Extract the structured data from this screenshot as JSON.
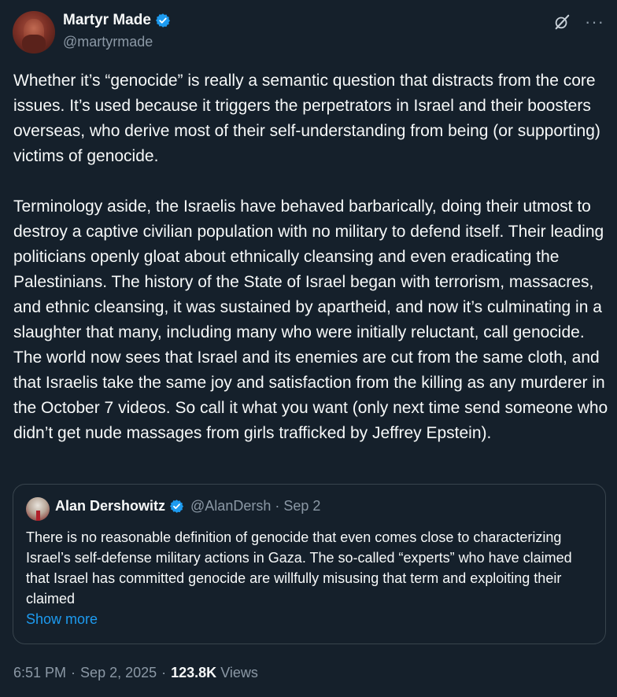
{
  "author": {
    "display_name": "Martyr Made",
    "handle": "@martyrmade",
    "verified": true
  },
  "icons": {
    "verified": "verified-badge-icon",
    "grok": "grok-icon",
    "more": "more-options-icon"
  },
  "colors": {
    "background": "#15202b",
    "text": "#f7f9f9",
    "secondary_text": "#8b98a5",
    "link": "#1d9bf0",
    "verified": "#1d9bf0",
    "border": "#38444d"
  },
  "tweet": {
    "text": "Whether it’s “genocide” is really a semantic question that distracts from the core issues. It’s used because it triggers the perpetrators in Israel and their boosters overseas, who derive most of their self-understanding from being (or supporting) victims of genocide.\n\nTerminology aside, the Israelis have behaved barbarically, doing their utmost to destroy a captive civilian population with no military to defend itself. Their leading politicians openly gloat about ethnically cleansing and even eradicating the Palestinians. The history of the State of Israel began with terrorism, massacres, and ethnic cleansing, it was sustained by apartheid, and now it’s culminating in a slaughter that many, including many who were initially reluctant, call genocide. The world now sees that Israel and its enemies are cut from the same cloth, and that Israelis take the same joy and satisfaction from the killing as any murderer in the October 7 videos. So call it what you want (only next time send someone who didn’t get nude massages from girls trafficked by Jeffrey Epstein)."
  },
  "quote": {
    "display_name": "Alan Dershowitz",
    "handle": "@AlanDersh",
    "separator": "·",
    "date": "Sep 2",
    "text": "There is no reasonable definition of genocide that even comes close to characterizing Israel’s self-defense military actions in Gaza. The so-called “experts” who have claimed that Israel has committed genocide are willfully misusing that term and exploiting their claimed",
    "show_more": "Show more"
  },
  "meta": {
    "time": "6:51 PM",
    "separator": "·",
    "date": "Sep 2, 2025",
    "views_count": "123.8K",
    "views_label": "Views"
  }
}
